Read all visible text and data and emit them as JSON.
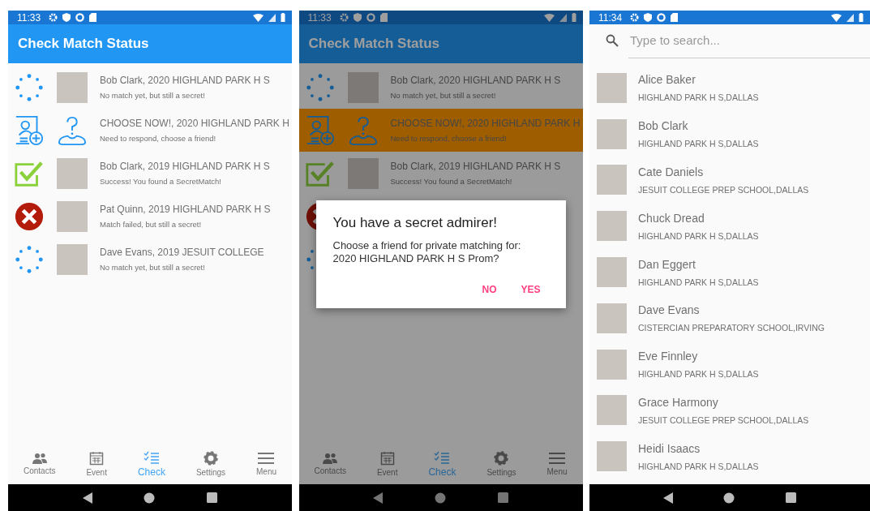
{
  "screens": [
    {
      "kind": "status",
      "status_bar": {
        "time": "11:33"
      },
      "title": "Check Match Status",
      "dimmed": false,
      "matches": [
        {
          "kind": "pending",
          "selected": false,
          "title": "Bob Clark, 2020 HIGHLAND PARK H S",
          "subtitle": "No match yet, but still a secret!"
        },
        {
          "kind": "choose",
          "selected": false,
          "title": "CHOOSE NOW!, 2020 HIGHLAND PARK H",
          "subtitle": "Need to respond, choose a friend!"
        },
        {
          "kind": "success",
          "selected": false,
          "title": "Bob Clark, 2019 HIGHLAND PARK H S",
          "subtitle": "Success! You found a SecretMatch!"
        },
        {
          "kind": "failed",
          "selected": false,
          "title": "Pat Quinn, 2019 HIGHLAND PARK H S",
          "subtitle": "Match failed, but still a secret!"
        },
        {
          "kind": "pending",
          "selected": false,
          "title": "Dave Evans, 2019 JESUIT COLLEGE",
          "subtitle": "No match yet, but still a secret!"
        }
      ],
      "tabs": [
        {
          "label": "Contacts",
          "selected": false
        },
        {
          "label": "Event",
          "selected": false
        },
        {
          "label": "Check",
          "selected": true
        },
        {
          "label": "Settings",
          "selected": false
        },
        {
          "label": "Menu",
          "selected": false
        }
      ]
    },
    {
      "kind": "status",
      "status_bar": {
        "time": "11:33"
      },
      "title": "Check Match Status",
      "dimmed": true,
      "matches": [
        {
          "kind": "pending",
          "selected": false,
          "title": "Bob Clark, 2020 HIGHLAND PARK H S",
          "subtitle": "No match yet, but still a secret!"
        },
        {
          "kind": "choose",
          "selected": true,
          "title": "CHOOSE NOW!, 2020 HIGHLAND PARK H",
          "subtitle": "Need to respond, choose a friend!"
        },
        {
          "kind": "success",
          "selected": false,
          "title": "Bob Clark, 2019 HIGHLAND PARK H S",
          "subtitle": "Success! You found a SecretMatch!"
        },
        {
          "kind": "failed",
          "selected": false
        },
        {
          "kind": "pending",
          "selected": false
        }
      ],
      "tabs": [
        {
          "label": "Contacts",
          "selected": false
        },
        {
          "label": "Event",
          "selected": false
        },
        {
          "label": "Check",
          "selected": true
        },
        {
          "label": "Settings",
          "selected": false
        },
        {
          "label": "Menu",
          "selected": false
        }
      ],
      "dialog": {
        "title": "You have a secret admirer!",
        "message": "Choose a friend for private matching for: 2020 HIGHLAND PARK H S Prom?",
        "buttons": [
          "NO",
          "YES"
        ]
      }
    },
    {
      "kind": "contacts",
      "status_bar": {
        "time": "11:34"
      },
      "search": {
        "placeholder": "Type to search..."
      },
      "contacts": [
        {
          "name": "Alice Baker",
          "school": "HIGHLAND PARK H S,DALLAS"
        },
        {
          "name": "Bob Clark",
          "school": "HIGHLAND PARK H S,DALLAS"
        },
        {
          "name": "Cate Daniels",
          "school": "JESUIT COLLEGE PREP SCHOOL,DALLAS"
        },
        {
          "name": "Chuck Dread",
          "school": "HIGHLAND PARK H S,DALLAS"
        },
        {
          "name": "Dan Eggert",
          "school": "HIGHLAND PARK H S,DALLAS"
        },
        {
          "name": "Dave Evans",
          "school": "CISTERCIAN PREPARATORY SCHOOL,IRVING"
        },
        {
          "name": "Eve Finnley",
          "school": "HIGHLAND PARK H S,DALLAS"
        },
        {
          "name": "Grace Harmony",
          "school": "JESUIT COLLEGE PREP SCHOOL,DALLAS"
        },
        {
          "name": "Heidi Isaacs",
          "school": "HIGHLAND PARK H S,DALLAS"
        }
      ]
    }
  ]
}
